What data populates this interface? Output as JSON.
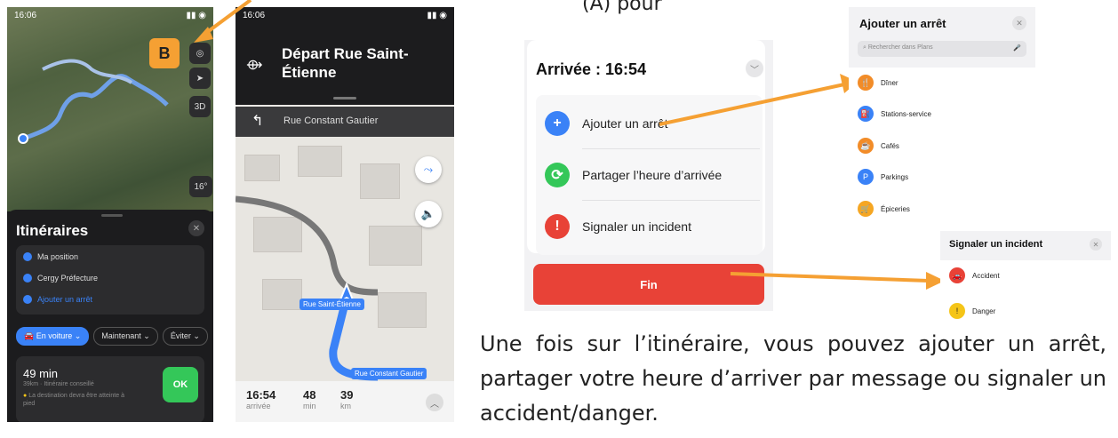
{
  "colors": {
    "accent": "#3a82f7",
    "orange": "#f5a033",
    "green": "#34c759",
    "red": "#e84237"
  },
  "top_fragment": "(A) pour",
  "screen_a": {
    "time": "16:06",
    "badge": "B",
    "map_buttons": [
      "◎",
      "➤",
      "3D"
    ],
    "temp": "16°",
    "title": "Itinéraires",
    "stops": [
      "Ma position",
      "Cergy Préfecture",
      "Ajouter un arrêt"
    ],
    "chips": [
      "🚘 En voiture ⌄",
      "Maintenant ⌄",
      "Éviter ⌄"
    ],
    "route": {
      "duration": "49 min",
      "sub": "39km · Itinéraire conseillé",
      "warning": "La destination devra être atteinte à pied",
      "ok": "OK"
    }
  },
  "screen_b": {
    "time": "16:06",
    "departure": "Départ Rue Saint-Étienne",
    "next_street": "Rue Constant Gautier",
    "labels": [
      "Rue Saint-Étienne",
      "Rue Constant Gautier"
    ],
    "stats": [
      {
        "value": "16:54",
        "unit": "arrivée"
      },
      {
        "value": "48",
        "unit": "min"
      },
      {
        "value": "39",
        "unit": "km"
      }
    ]
  },
  "screen_c": {
    "title": "Arrivée : 16:54",
    "options": [
      {
        "label": "Ajouter un arrêt",
        "icon": "+",
        "color": "#3a82f7"
      },
      {
        "label": "Partager l’heure d’arrivée",
        "icon": "⟳",
        "color": "#34c759"
      },
      {
        "label": "Signaler un incident",
        "icon": "!",
        "color": "#e84237"
      }
    ],
    "end_label": "Fin"
  },
  "panel_d": {
    "title": "Ajouter un arrêt",
    "search_placeholder": "Rechercher dans Plans",
    "items": [
      {
        "label": "Dîner",
        "icon": "🍴",
        "color": "#f28c28"
      },
      {
        "label": "Stations-service",
        "icon": "⛽",
        "color": "#3a82f7"
      },
      {
        "label": "Cafés",
        "icon": "☕",
        "color": "#f28c28"
      },
      {
        "label": "Parkings",
        "icon": "P",
        "color": "#3a82f7"
      },
      {
        "label": "Épiceries",
        "icon": "🛒",
        "color": "#f5a623"
      }
    ]
  },
  "panel_e": {
    "title": "Signaler un incident",
    "items": [
      {
        "label": "Accident",
        "icon": "🚗",
        "color": "#e84237"
      },
      {
        "label": "Danger",
        "icon": "!",
        "color": "#f5c518"
      }
    ]
  },
  "caption": "Une fois sur l’itinéraire, vous pouvez ajouter un arrêt, partager votre heure d’arriver par message ou signaler un accident/danger."
}
